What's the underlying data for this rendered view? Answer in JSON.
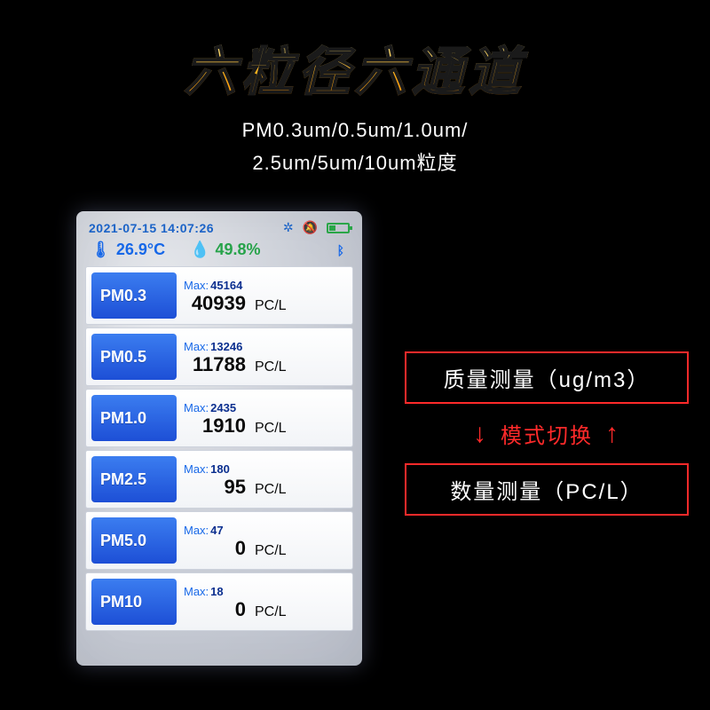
{
  "headline": "六粒径六通道",
  "subtitle1": "PM0.3um/0.5um/1.0um/",
  "subtitle2": "2.5um/5um/10um粒度",
  "device": {
    "datetime": "2021-07-15 14:07:26",
    "temperature": "26.9°C",
    "humidity": "49.8%",
    "unit": "PC/L",
    "max_label": "Max:",
    "rows": [
      {
        "name": "PM0.3",
        "max": "45164",
        "value": "40939"
      },
      {
        "name": "PM0.5",
        "max": "13246",
        "value": "11788"
      },
      {
        "name": "PM1.0",
        "max": "2435",
        "value": "1910"
      },
      {
        "name": "PM2.5",
        "max": "180",
        "value": "95"
      },
      {
        "name": "PM5.0",
        "max": "47",
        "value": "0"
      },
      {
        "name": "PM10",
        "max": "18",
        "value": "0"
      }
    ]
  },
  "side": {
    "box1": "质量测量（ug/m3）",
    "mode_switch": "模式切换",
    "box2": "数量测量（PC/L）",
    "arrow_down": "↓",
    "arrow_up": "↑"
  }
}
